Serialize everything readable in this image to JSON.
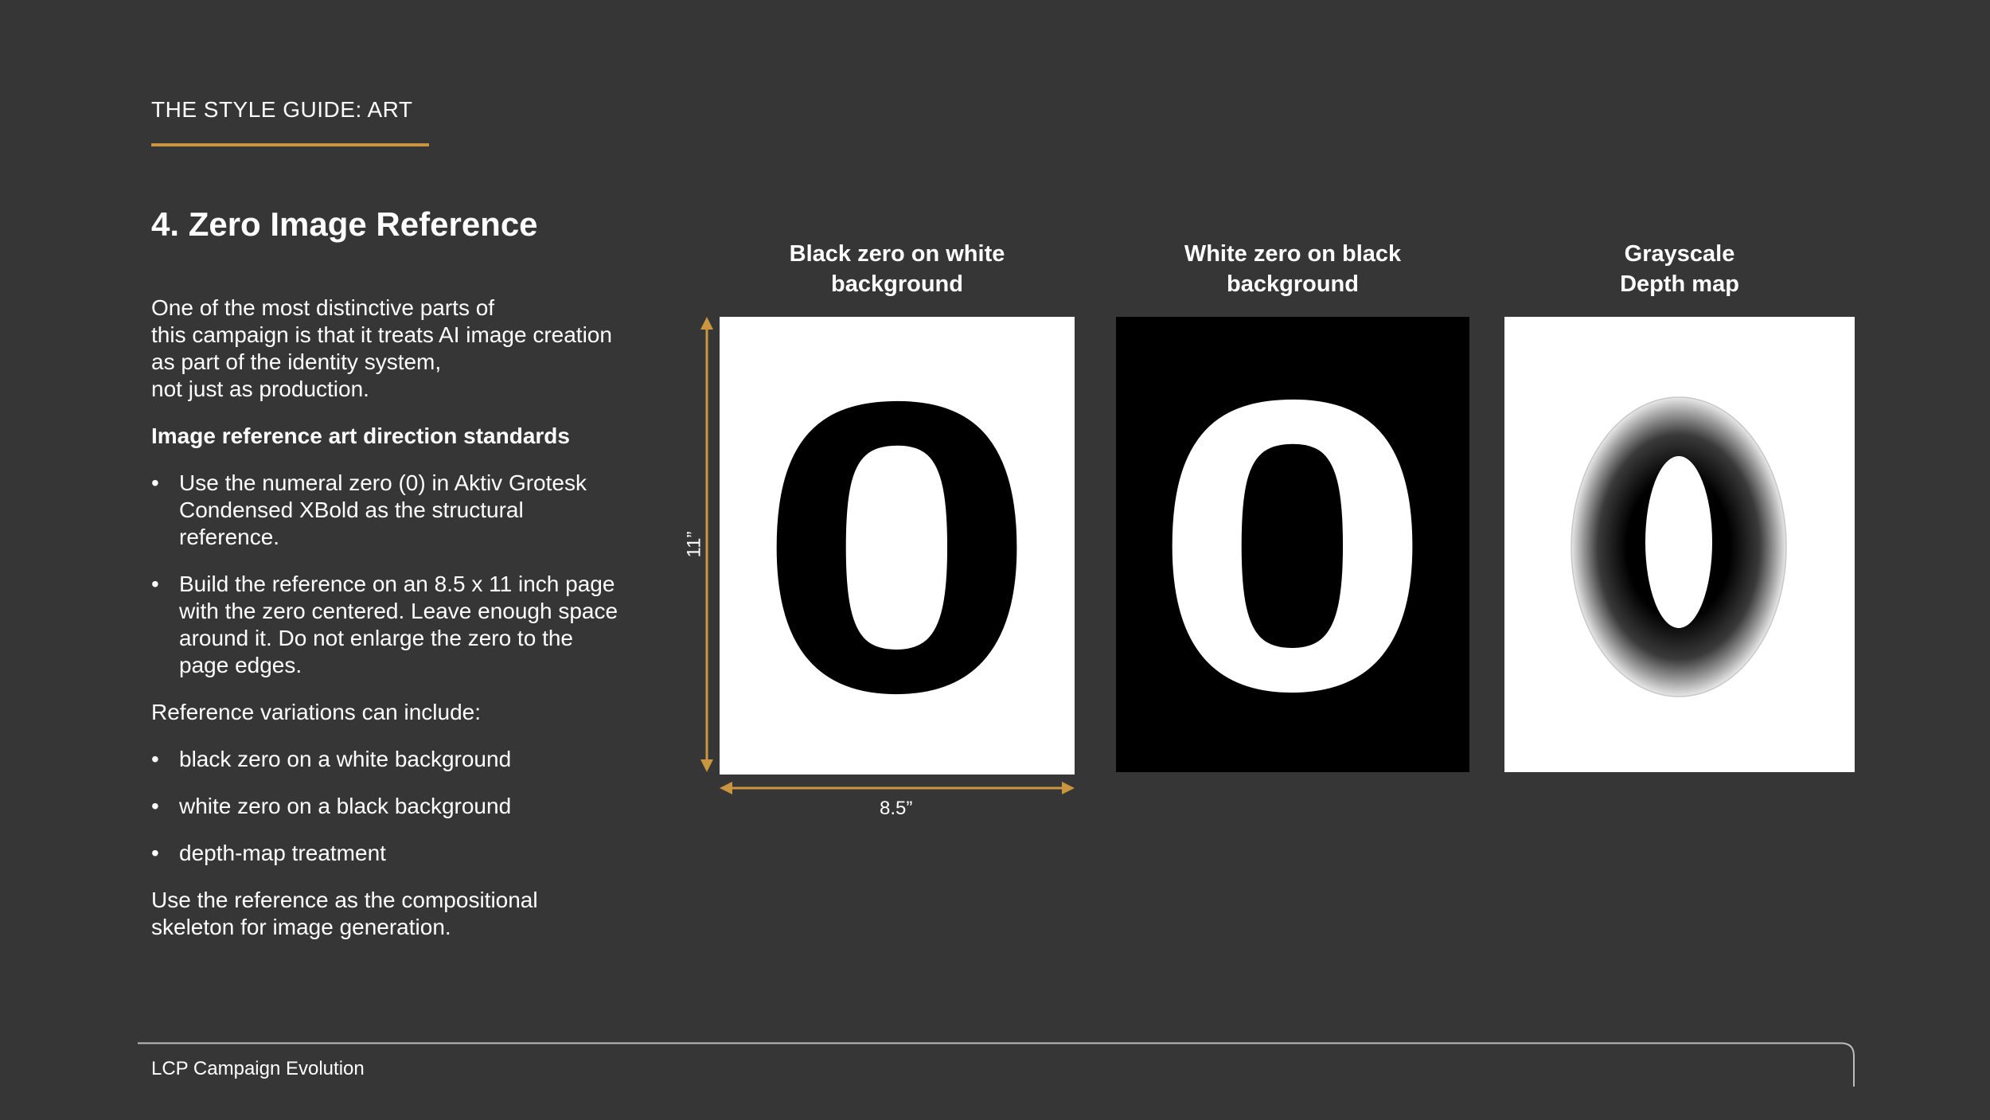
{
  "header": {
    "eyebrow": "THE STYLE GUIDE: ART",
    "accent_color": "#c9963f"
  },
  "title": "4. Zero Image Reference",
  "intro": {
    "line1": "One of the most distinctive parts of",
    "line2": "this campaign is that it treats AI image creation",
    "line3": "as part of the identity system,",
    "line4": "not just as production."
  },
  "standards_heading": "Image reference art direction standards",
  "bullet_marker": "•",
  "standards": [
    {
      "lines": [
        "Use the numeral zero (0) in Aktiv Grotesk",
        "Condensed XBold as the structural",
        "reference."
      ]
    },
    {
      "lines": [
        "Build the reference on an 8.5 x 11 inch page",
        "with the zero centered. Leave enough space",
        "around it. Do not enlarge the zero to the",
        "page edges."
      ]
    }
  ],
  "variations_intro": "Reference variations can include:",
  "variations": [
    "black zero on a white background",
    "white zero on a black background",
    "depth-map treatment"
  ],
  "closing": {
    "line1": "Use the reference as the compositional",
    "line2": "skeleton for image generation."
  },
  "panels": [
    {
      "caption_line1": "Black zero on white",
      "caption_line2": "background",
      "glyph": "0",
      "background": "#ffffff",
      "foreground": "#000000"
    },
    {
      "caption_line1": "White zero on black",
      "caption_line2": "background",
      "glyph": "0",
      "background": "#000000",
      "foreground": "#ffffff"
    },
    {
      "caption_line1": "Grayscale",
      "caption_line2": "Depth map",
      "glyph": "0",
      "background": "#ffffff",
      "foreground": "#000000"
    }
  ],
  "dimensions": {
    "width_label": "8.5”",
    "height_label": "11”"
  },
  "footer": {
    "text": "LCP Campaign Evolution"
  }
}
